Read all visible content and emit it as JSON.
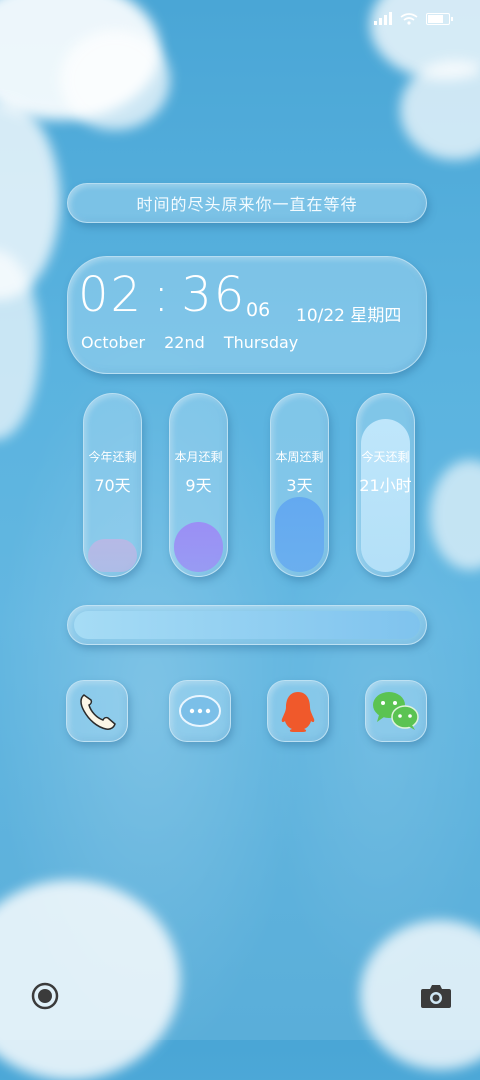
{
  "quote": "时间的尽头原来你一直在等待",
  "clock": {
    "hours": "02",
    "colon": ":",
    "minutes": "36",
    "seconds": "06",
    "date": "10/22 星期四",
    "month": "October",
    "day": "22nd",
    "weekday": "Thursday"
  },
  "remaining": [
    {
      "label": "今年还剩",
      "value": "70天",
      "fraction": 0.19,
      "color": "#b6b9e6"
    },
    {
      "label": "本月还剩",
      "value": "9天",
      "fraction": 0.29,
      "color": "#9b8ff5"
    },
    {
      "label": "本周还剩",
      "value": "3天",
      "fraction": 0.43,
      "color": "#64a9f0"
    },
    {
      "label": "今天还剩",
      "value": "21小时",
      "fraction": 0.88,
      "color": "#bfe6fb"
    }
  ],
  "progress_fraction": 1.0,
  "dock": [
    {
      "name": "phone-icon"
    },
    {
      "name": "messages-icon"
    },
    {
      "name": "qq-icon"
    },
    {
      "name": "wechat-icon"
    }
  ],
  "colors": {
    "accent": "#5ab3df",
    "qq_red": "#f0592b",
    "wechat_green": "#5bc352"
  }
}
